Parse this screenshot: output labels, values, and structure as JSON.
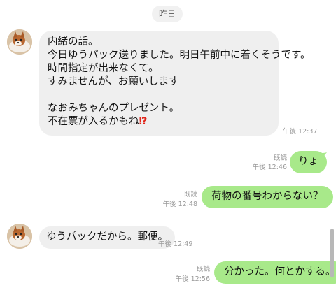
{
  "date_separator": "昨日",
  "messages": [
    {
      "direction": "incoming",
      "lines": [
        "内緒の話。",
        "今日ゆうパック送りました。明日午前中に着くそうです。",
        "時間指定が出来なくて。",
        "すみませんが、お願いします",
        "",
        "なおみちゃんのプレゼント。",
        "不在票が入るかもね"
      ],
      "emoji": "⁉",
      "time": "午後 12:37"
    },
    {
      "direction": "outgoing",
      "text": "りょ",
      "read": "既読",
      "time": "午後 12:46"
    },
    {
      "direction": "outgoing",
      "text": "荷物の番号わからない？",
      "read": "既読",
      "time": "午後 12:48"
    },
    {
      "direction": "incoming",
      "text": "ゆうパックだから。郵便。",
      "time": "午後 12:49"
    },
    {
      "direction": "outgoing",
      "text": "分かった。何とかする。",
      "read": "既読",
      "time": "午後 12:56"
    }
  ],
  "colors": {
    "incoming_bubble": "#efefef",
    "outgoing_bubble": "#a8e98a",
    "emoji": "#e0261b"
  }
}
